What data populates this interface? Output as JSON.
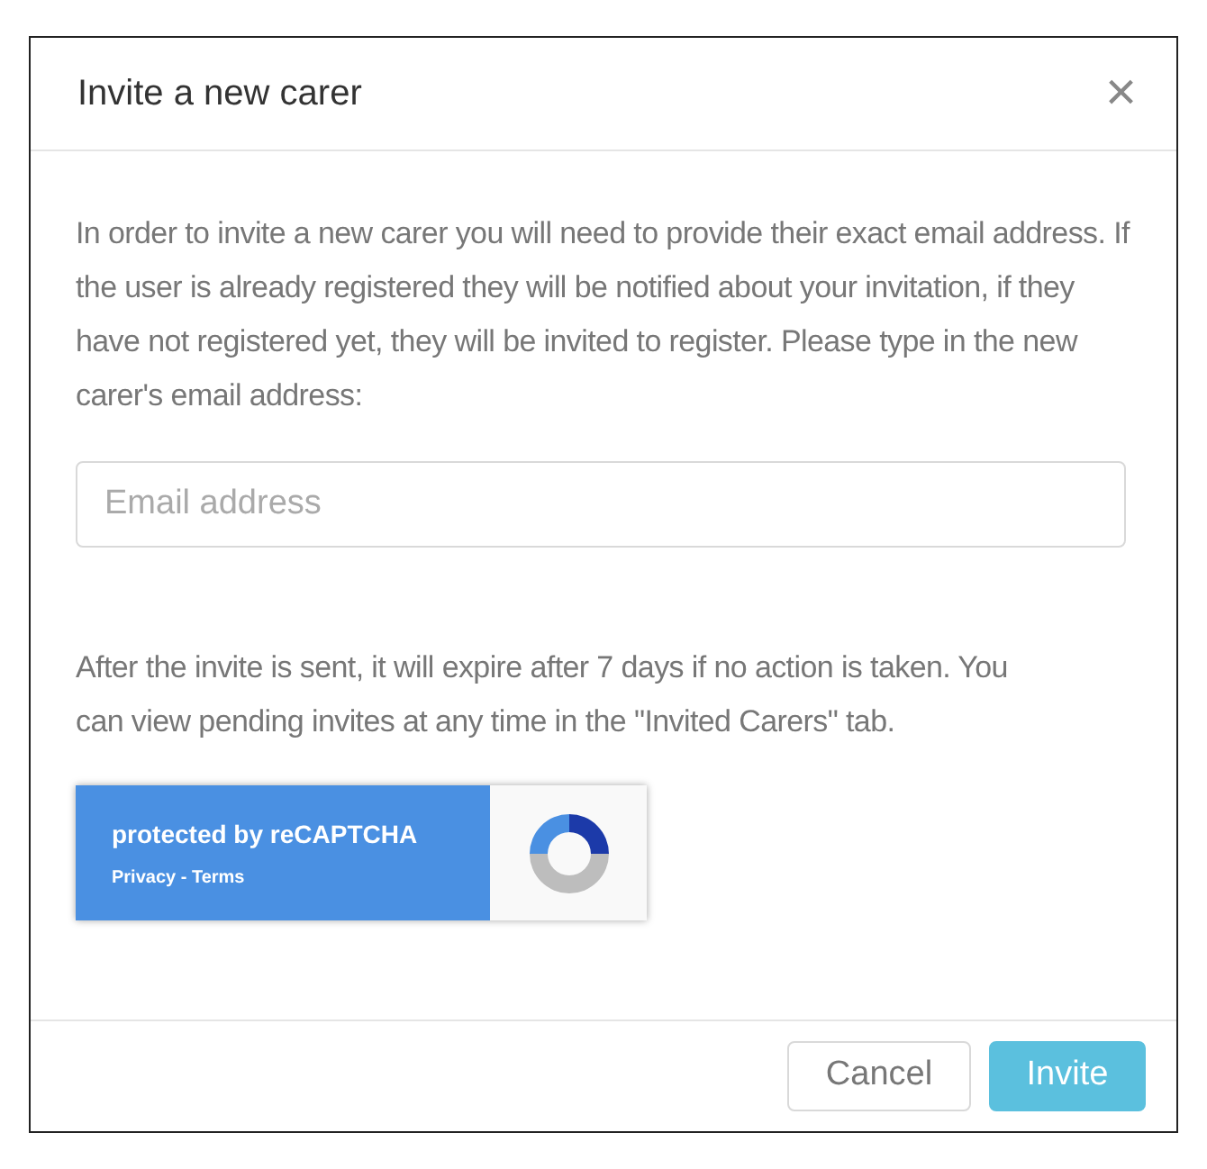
{
  "dialog": {
    "title": "Invite a new carer",
    "close_icon": "×"
  },
  "intro": "In order to invite a new carer you will need to provide their exact email address. If the user is already registered they will be notified about your invitation, if they have not registered yet, they will be invited to register. Please type in the new carer's email address:",
  "email_field": {
    "placeholder": "Email address"
  },
  "note": "After the invite is sent, it will expire after 7 days if no action is taken. You can view pending invites at any time in the \"Invited Carers\" tab.",
  "recaptcha": {
    "title": "protected by reCAPTCHA",
    "links": "Privacy - Terms"
  },
  "buttons": [
    {
      "label": "Cancel",
      "kind": "secondary"
    },
    {
      "label": "Invite",
      "kind": "primary"
    }
  ]
}
